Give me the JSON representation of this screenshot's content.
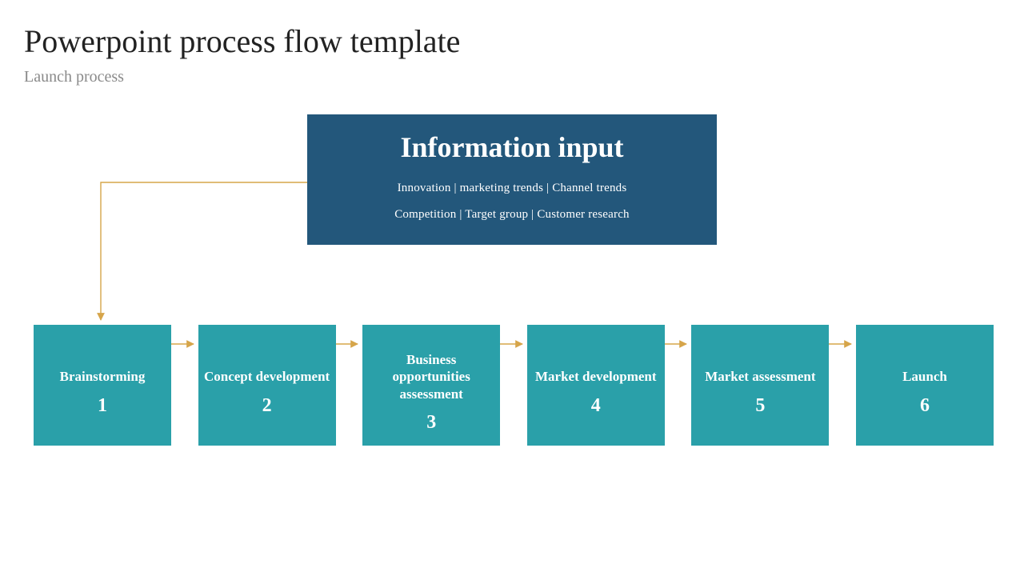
{
  "title": "Powerpoint process flow template",
  "subtitle": "Launch process",
  "info_box": {
    "heading": "Information input",
    "line1": "Innovation | marketing trends | Channel trends",
    "line2": "Competition | Target group | Customer research"
  },
  "steps": [
    {
      "label": "Brainstorming",
      "num": "1"
    },
    {
      "label": "Concept development",
      "num": "2"
    },
    {
      "label": "Business opportunities assessment",
      "num": "3"
    },
    {
      "label": "Market development",
      "num": "4"
    },
    {
      "label": "Market assessment",
      "num": "5"
    },
    {
      "label": "Launch",
      "num": "6"
    }
  ],
  "colors": {
    "info_bg": "#23577b",
    "step_bg": "#2aa0a9",
    "connector": "#d6a54a"
  }
}
